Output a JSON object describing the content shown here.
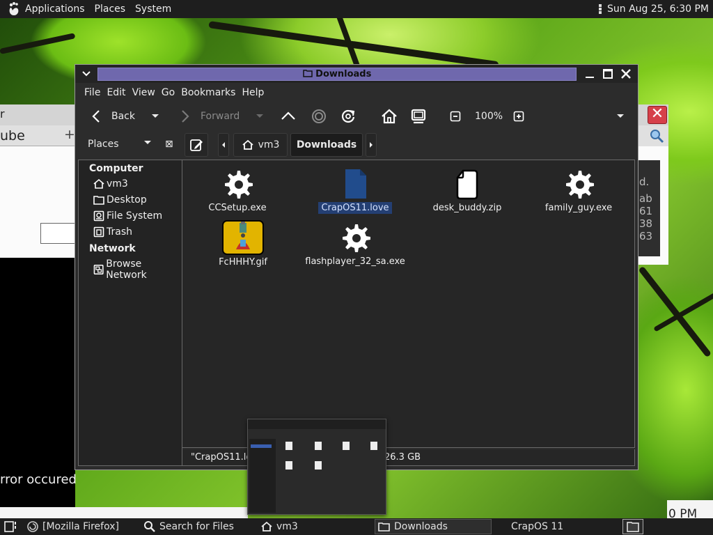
{
  "top_panel": {
    "menus": [
      "Applications",
      "Places",
      "System"
    ],
    "clock": "Sun Aug 25,  6:30 PM",
    "icons": [
      "gnome-foot-icon",
      "panel-menu-icon"
    ]
  },
  "background_windows": {
    "left_tab_text": "ube",
    "left_title_text": "r",
    "error_text": "rror occured",
    "right_side_text": [
      "d.",
      "ab",
      "61",
      "38",
      "63"
    ],
    "right_bottom_text": "0 PM"
  },
  "window": {
    "title": "Downloads",
    "menu": [
      "File",
      "Edit",
      "View",
      "Go",
      "Bookmarks",
      "Help"
    ],
    "toolbar": {
      "back": "Back",
      "forward": "Forward",
      "zoom": "100%"
    },
    "location": {
      "places_label": "Places",
      "crumbs": [
        "vm3",
        "Downloads"
      ],
      "active_crumb": "Downloads"
    },
    "sidebar": {
      "sections": [
        {
          "heading": "Computer",
          "items": [
            {
              "label": "vm3",
              "icon": "home-icon"
            },
            {
              "label": "Desktop",
              "icon": "folder-icon"
            },
            {
              "label": "File System",
              "icon": "drive-icon"
            },
            {
              "label": "Trash",
              "icon": "trash-icon"
            }
          ]
        },
        {
          "heading": "Network",
          "items": [
            {
              "label": "Browse Network",
              "icon": "network-icon"
            }
          ]
        }
      ]
    },
    "files": [
      {
        "name": "CCSetup.exe",
        "icon": "executable-gear-icon",
        "selected": false
      },
      {
        "name": "CrapOS11.love",
        "icon": "document-icon",
        "selected": true
      },
      {
        "name": "desk_buddy.zip",
        "icon": "archive-icon",
        "selected": false
      },
      {
        "name": "family_guy.exe",
        "icon": "executable-gear-icon",
        "selected": false
      },
      {
        "name": "FcHHHY.gif",
        "icon": "image-thumbnail-icon",
        "selected": false
      },
      {
        "name": "flashplayer_32_sa.exe",
        "icon": "executable-gear-icon",
        "selected": false
      }
    ],
    "status": {
      "left": "\"CrapOS11.lo",
      "right": "26.3 GB"
    }
  },
  "taskbar": {
    "tasks": [
      {
        "label": "[Mozilla Firefox]",
        "icon": "firefox-icon",
        "active": false
      },
      {
        "label": "Search for Files",
        "icon": "search-icon",
        "active": false
      },
      {
        "label": "vm3",
        "icon": "home-icon",
        "active": false
      },
      {
        "label": "Downloads",
        "icon": "folder-icon",
        "active": true
      },
      {
        "label": "CrapOS 11",
        "icon": "",
        "active": false
      }
    ]
  },
  "colors": {
    "title_strip": "#6f68ad",
    "selection": "#243f73",
    "panel_bg": "#1e1e1e",
    "close_button": "#d6404a"
  }
}
